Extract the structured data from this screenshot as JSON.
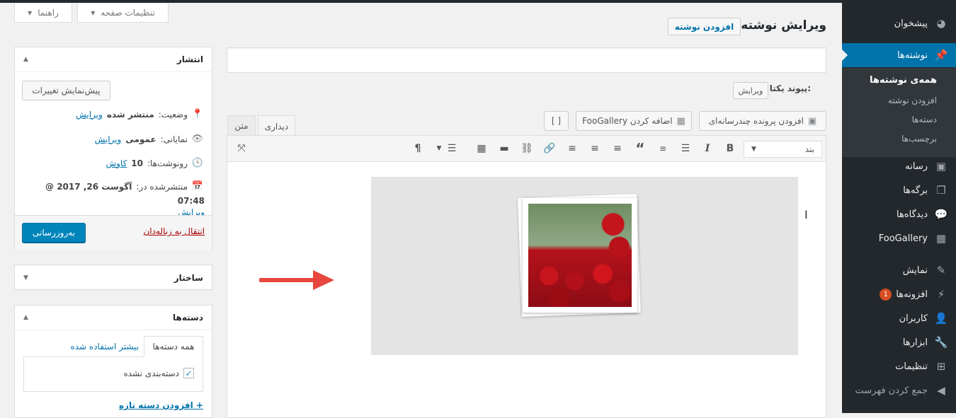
{
  "admin_menu": {
    "items": [
      {
        "label": "پیشخوان",
        "icon": "dashboard-icon"
      },
      {
        "label": "نوشته‌ها",
        "icon": "pin-icon"
      },
      {
        "label": "رسانه",
        "icon": "media-icon"
      },
      {
        "label": "برگه‌ها",
        "icon": "pages-icon"
      },
      {
        "label": "دیدگاه‌ها",
        "icon": "comments-icon"
      },
      {
        "label": "FooGallery",
        "icon": "gallery-icon"
      },
      {
        "label": "نمایش",
        "icon": "brush-icon"
      },
      {
        "label": "افزونه‌ها",
        "icon": "plugin-icon",
        "badge": "1"
      },
      {
        "label": "کاربران",
        "icon": "users-icon"
      },
      {
        "label": "ابزارها",
        "icon": "wrench-icon"
      },
      {
        "label": "تنظیمات",
        "icon": "settings-icon"
      },
      {
        "label": "جمع کردن فهرست",
        "icon": "collapse-icon"
      }
    ],
    "submenu": [
      "همه‌ی نوشته‌ها",
      "افزودن نوشته",
      "دسته‌ها",
      "برچسب‌ها"
    ]
  },
  "screen_meta": {
    "options": "تنظیمات صفحه",
    "help": "راهنما"
  },
  "page": {
    "title": "ویرایش نوشته",
    "add_new": "افزودن نوشته",
    "permalink_label": "پیوند یکتا:",
    "permalink_edit": "ویرایش"
  },
  "editor": {
    "add_media": "افزودن پرونده چندرسانه‌ای",
    "add_foogallery": "اضافه کردن FooGallery",
    "shortcode_btn": "[ ]",
    "tab_visual": "دیداری",
    "tab_text": "متن",
    "format_select": "بند"
  },
  "publish": {
    "title": "انتشار",
    "preview": "پیش‌نمایش تغییرات",
    "status_label": "وضعیت:",
    "status_value": "منتشر شده",
    "visibility_label": "نمایانی:",
    "visibility_value": "عمومی",
    "revisions_label": "رونوشت‌ها:",
    "revisions_value": "10",
    "browse": "کاوش",
    "published_label": "منتشرشده در:",
    "published_date": "آگوست 26, 2017 @",
    "published_time": "07:48",
    "edit": "ویرایش",
    "trash": "انتقال به زباله‌دان",
    "update": "به‌روزرسانی"
  },
  "structure_box": {
    "title": "ساختار"
  },
  "categories_box": {
    "title": "دسته‌ها",
    "tab_all": "همه دسته‌ها",
    "tab_popular": "بیشتر استفاده شده",
    "items": [
      {
        "label": "دسته‌بندی نشده",
        "checked": true
      }
    ],
    "add_new": "+ افزودن دسته تازه"
  }
}
